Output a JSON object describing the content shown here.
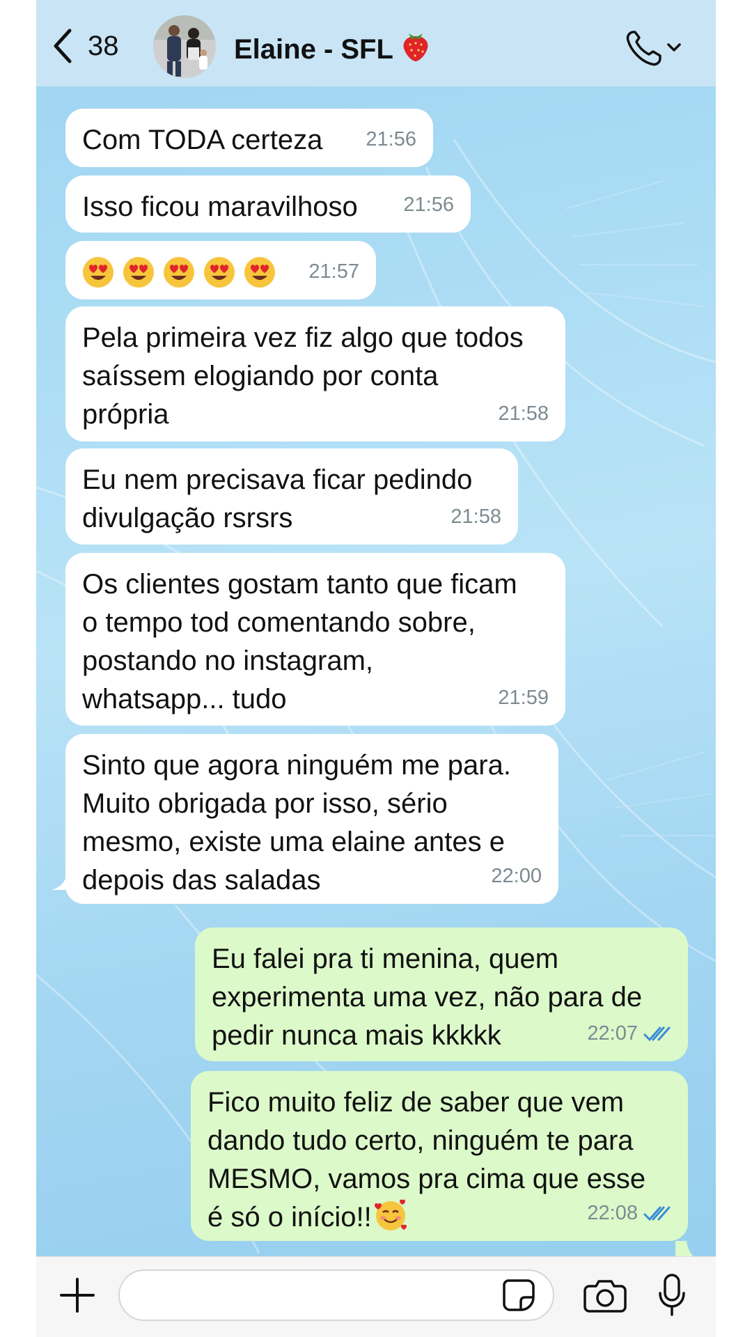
{
  "header": {
    "back_count": "38",
    "contact_name": "Elaine - SFL",
    "name_icon": "strawberry-icon",
    "avatar": "contact-photo",
    "call_icon": "phone-chevron-icon"
  },
  "messages": [
    {
      "direction": "in",
      "lines": [
        "Com TODA certeza"
      ],
      "time": "21:56"
    },
    {
      "direction": "in",
      "lines": [
        "Isso ficou maravilhoso"
      ],
      "time": "21:56"
    },
    {
      "direction": "in",
      "emoji": "heart-eyes-face",
      "emoji_count": 5,
      "time": "21:57"
    },
    {
      "direction": "in",
      "lines": [
        "Pela primeira vez fiz algo que todos",
        "saíssem elogiando por conta",
        "própria"
      ],
      "time": "21:58"
    },
    {
      "direction": "in",
      "lines": [
        "Eu nem precisava ficar pedindo",
        "divulgação rsrsrs"
      ],
      "time": "21:58"
    },
    {
      "direction": "in",
      "lines": [
        "Os clientes gostam tanto que ficam",
        "o tempo tod comentando sobre,",
        "postando no instagram,",
        "whatsapp... tudo"
      ],
      "time": "21:59"
    },
    {
      "direction": "in",
      "lines": [
        "Sinto que agora ninguém me para.",
        "Muito obrigada por isso, sério",
        "mesmo, existe uma elaine antes e",
        "depois das saladas"
      ],
      "time": "22:00"
    },
    {
      "direction": "out",
      "lines": [
        "Eu falei pra ti menina, quem",
        "experimenta uma vez, não para de",
        "pedir nunca mais kkkkk"
      ],
      "time": "22:07",
      "status": "read"
    },
    {
      "direction": "out",
      "lines": [
        "Fico muito feliz de saber que vem",
        "dando tudo certo, ninguém te para",
        "MESMO, vamos pra cima que esse",
        "é só o início!!"
      ],
      "emoji_end": "smiling-face-with-hearts",
      "time": "22:08",
      "status": "read"
    }
  ],
  "composer": {
    "input_value": "",
    "icons": [
      "plus-icon",
      "sticker-icon",
      "camera-icon",
      "microphone-icon"
    ]
  },
  "colors": {
    "header_bg": "#c9e5f5",
    "incoming_bubble": "#ffffff",
    "outgoing_bubble": "#dcf9c9",
    "read_ticks": "#3a8bd8",
    "timestamp": "#7d8a90",
    "composer_bg": "#f6f6f6"
  }
}
